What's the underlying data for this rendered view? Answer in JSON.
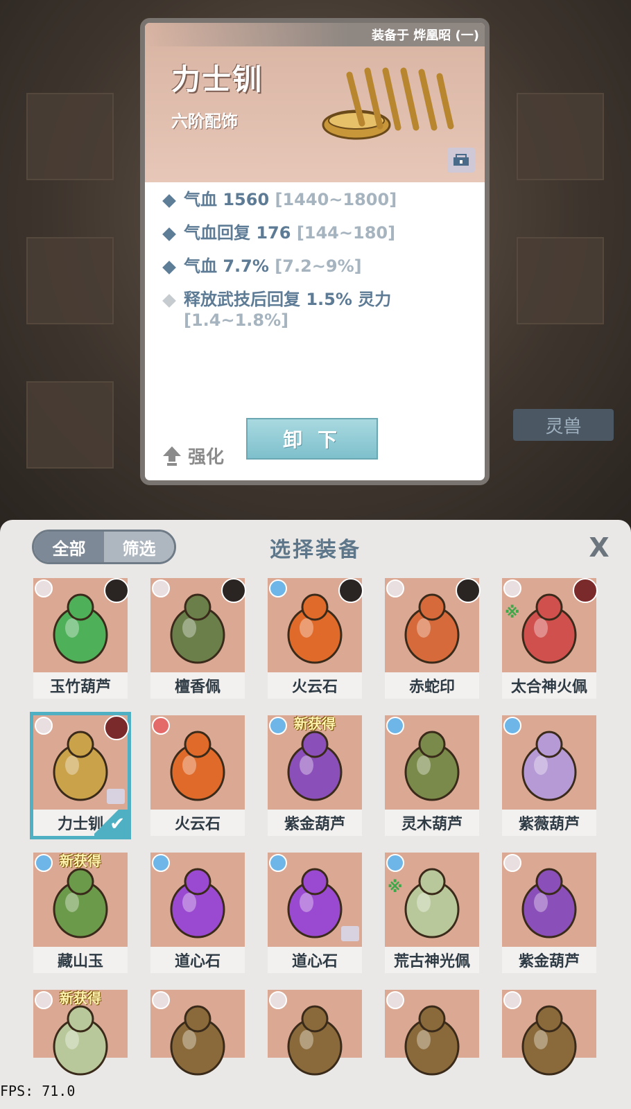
{
  "detail": {
    "equipped_on": "装备于 烨凰昭 (一)",
    "name": "力士钏",
    "grade": "六阶配饰",
    "stats": [
      {
        "label": "气血 1560",
        "range": "[1440~1800]"
      },
      {
        "label": "气血回复 176",
        "range": "[144~180]"
      },
      {
        "label": "气血 7.7%",
        "range": "[7.2~9%]"
      },
      {
        "label": "释放武技后回复 1.5% 灵力",
        "range": "[1.4~1.8%]"
      }
    ],
    "enhance_label": "强化",
    "unequip_label": "卸 下"
  },
  "background": {
    "tab_label": "灵兽"
  },
  "panel": {
    "filter_all": "全部",
    "filter_select": "筛选",
    "title": "选择装备",
    "close_label": "X"
  },
  "items": [
    {
      "name": "玉竹葫芦",
      "art_color": "#4fb05a"
    },
    {
      "name": "檀香佩",
      "art_color": "#6b7f4a"
    },
    {
      "name": "火云石",
      "art_color": "#e06a2a"
    },
    {
      "name": "赤蛇印",
      "art_color": "#d66a3a"
    },
    {
      "name": "太合神火佩",
      "art_color": "#d0504e"
    },
    {
      "name": "力士钏",
      "art_color": "#c9a24a"
    },
    {
      "name": "火云石",
      "art_color": "#e06a2a"
    },
    {
      "name": "紫金葫芦",
      "art_color": "#8a4fb8",
      "new_tag": "新获得"
    },
    {
      "name": "灵木葫芦",
      "art_color": "#7a8a4a"
    },
    {
      "name": "紫薇葫芦",
      "art_color": "#b59ad6"
    },
    {
      "name": "藏山玉",
      "art_color": "#6a9a4a",
      "new_tag": "新获得"
    },
    {
      "name": "道心石",
      "art_color": "#9a4ad0"
    },
    {
      "name": "道心石",
      "art_color": "#9a4ad0"
    },
    {
      "name": "荒古神光佩",
      "art_color": "#b8c89a"
    },
    {
      "name": "紫金葫芦",
      "art_color": "#8a4fb8"
    },
    {
      "name": "",
      "art_color": "#b8c89a",
      "new_tag": "新获得"
    },
    {
      "name": "",
      "art_color": "#8a6a3a"
    },
    {
      "name": "",
      "art_color": "#8a6a3a"
    },
    {
      "name": "",
      "art_color": "#8a6a3a"
    },
    {
      "name": "",
      "art_color": "#8a6a3a"
    }
  ],
  "fps": "FPS: 71.0",
  "colors": {
    "accent_blue": "#5d7b95",
    "selected_outline": "#4fb0c3",
    "button_cyan": "#7ec0cc"
  }
}
